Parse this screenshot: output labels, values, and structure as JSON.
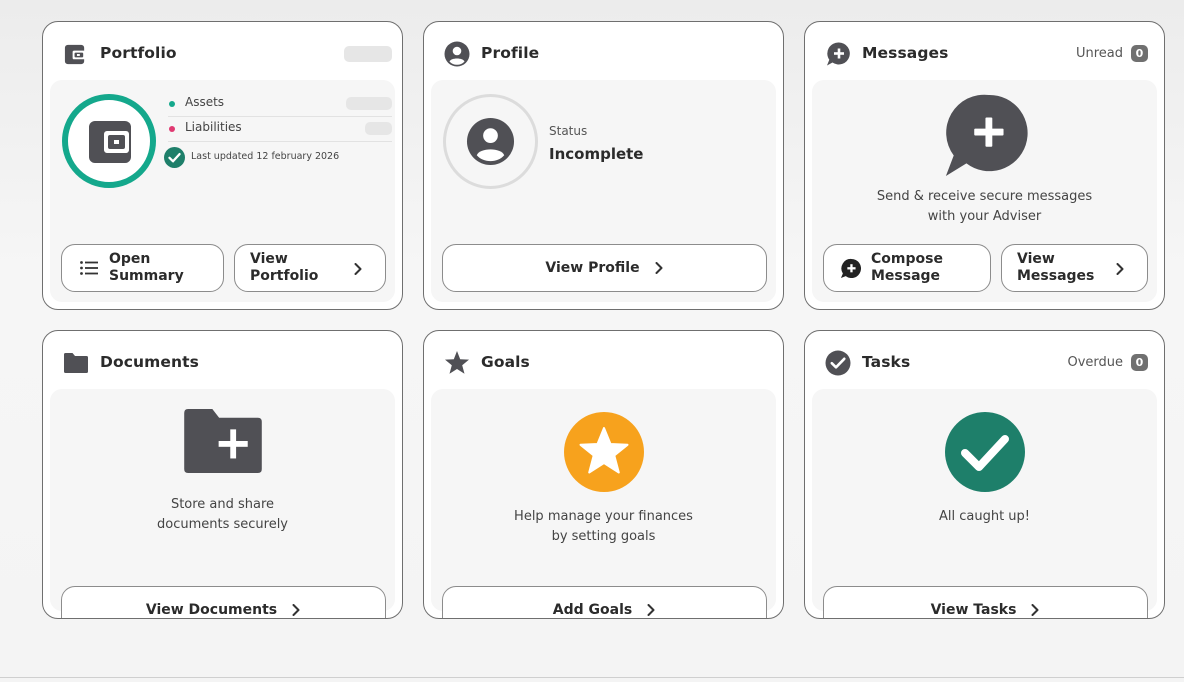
{
  "colors": {
    "accent_teal": "#14a88c",
    "liabilities_pink": "#e03a72",
    "goals_orange": "#f7a21d",
    "tasks_green": "#1e7f6a",
    "icon_dark": "#505055"
  },
  "portfolio": {
    "title": "Portfolio",
    "icon": "wallet-icon",
    "legend": {
      "assets": "Assets",
      "liabilities": "Liabilities"
    },
    "last_updated": "Last updated 12 february 2026",
    "buttons": {
      "open_summary_line1": "Open",
      "open_summary_line2": "Summary",
      "view_portfolio_line1": "View",
      "view_portfolio_line2": "Portfolio"
    }
  },
  "profile": {
    "title": "Profile",
    "icon": "user-circle-icon",
    "status_label": "Status",
    "status_value": "Incomplete",
    "button": "View Profile"
  },
  "messages": {
    "title": "Messages",
    "icon": "message-plus-icon",
    "unread_label": "Unread",
    "unread_count": "0",
    "text_line1": "Send & receive secure messages",
    "text_line2": "with your Adviser",
    "buttons": {
      "compose_line1": "Compose",
      "compose_line2": "Message",
      "view_line1": "View",
      "view_line2": "Messages"
    }
  },
  "documents": {
    "title": "Documents",
    "icon": "folder-icon",
    "text_line1": "Store and share",
    "text_line2": "documents securely",
    "button": "View Documents"
  },
  "goals": {
    "title": "Goals",
    "icon": "star-icon",
    "text_line1": "Help manage your finances",
    "text_line2": "by setting goals",
    "button": "Add Goals"
  },
  "tasks": {
    "title": "Tasks",
    "icon": "check-circle-icon",
    "overdue_label": "Overdue",
    "overdue_count": "0",
    "text": "All caught up!",
    "button": "View Tasks"
  }
}
